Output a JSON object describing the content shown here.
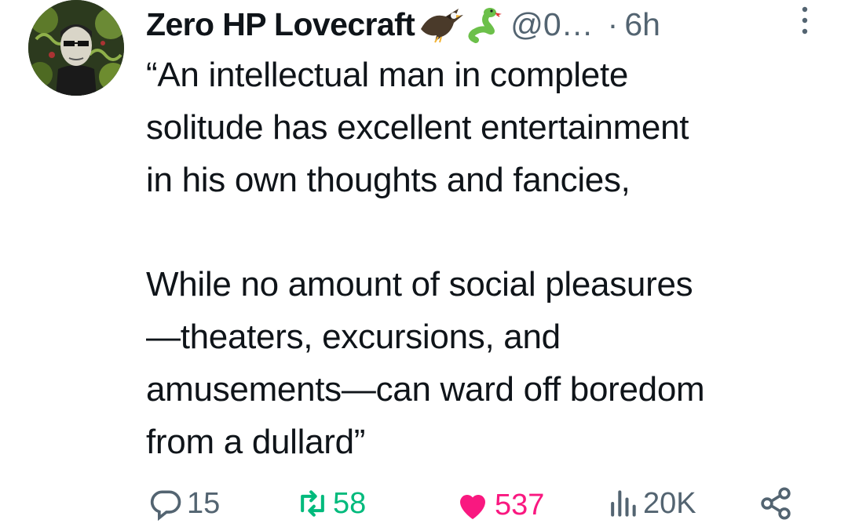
{
  "tweet": {
    "author": {
      "display_name": "Zero HP Lovecraft",
      "emoji_icons": [
        "eagle-icon",
        "snake-icon"
      ],
      "handle": "@0…",
      "separator": "·",
      "time": "6h"
    },
    "text_paragraphs": [
      "“An intellectual man in complete solitude has excellent entertainment in his own thoughts and fancies,",
      "While no amount of social pleasures —theaters, excursions, and amusements—can ward off boredom from a dullard”"
    ],
    "text_lines": [
      [
        "“An intellectual man in complete",
        "solitude has excellent entertainment",
        "in his own thoughts and fancies,"
      ],
      [
        "While no amount of social pleasures",
        "—theaters, excursions, and",
        "amusements—can ward off boredom",
        "from a dullard”"
      ]
    ],
    "actions": {
      "replies": "15",
      "reposts": "58",
      "likes": "537",
      "views": "20K"
    },
    "colors": {
      "text": "#0f1419",
      "secondary": "#536471",
      "repost": "#00ba7c",
      "like": "#f91880"
    },
    "icons": [
      "more-icon",
      "reply-icon",
      "repost-icon",
      "heart-icon",
      "views-icon",
      "share-icon"
    ]
  }
}
